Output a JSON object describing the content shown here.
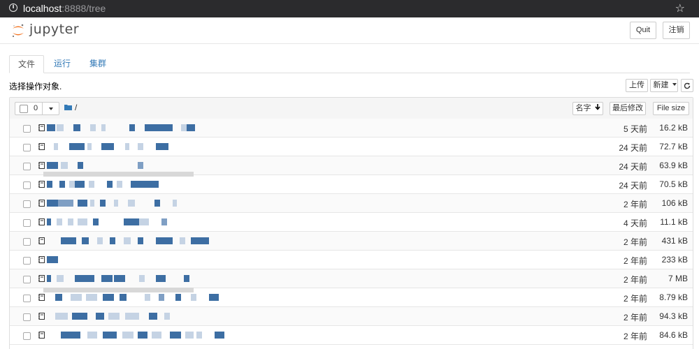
{
  "browser": {
    "url_host": "localhost",
    "url_rest": ":8888/tree"
  },
  "header": {
    "logo_text": "jupyter",
    "quit_label": "Quit",
    "logout_label": "注销"
  },
  "tabs": [
    {
      "label": "文件",
      "active": true
    },
    {
      "label": "运行",
      "active": false
    },
    {
      "label": "集群",
      "active": false
    }
  ],
  "toolbar": {
    "hint": "选择操作对象.",
    "upload_label": "上传",
    "new_label": "新建",
    "refresh_icon": "refresh-icon"
  },
  "list_header": {
    "selected_count": "0",
    "breadcrumb_root": "/",
    "sort_name_label": "名字",
    "sort_modified_label": "最后修改",
    "sort_size_label": "File size"
  },
  "files": [
    {
      "modified": "5 天前",
      "size": "16.2 kB"
    },
    {
      "modified": "24 天前",
      "size": "72.7 kB"
    },
    {
      "modified": "24 天前",
      "size": "63.9 kB"
    },
    {
      "modified": "24 天前",
      "size": "70.5 kB"
    },
    {
      "modified": "2 年前",
      "size": "106 kB"
    },
    {
      "modified": "4 天前",
      "size": "11.1 kB"
    },
    {
      "modified": "2 年前",
      "size": "431 kB"
    },
    {
      "modified": "2 年前",
      "size": "233 kB"
    },
    {
      "modified": "2 年前",
      "size": "7 MB"
    },
    {
      "modified": "2 年前",
      "size": "8.79 kB"
    },
    {
      "modified": "2 年前",
      "size": "94.3 kB"
    },
    {
      "modified": "2 年前",
      "size": "84.6 kB"
    }
  ],
  "colors": {
    "link": "#337ab7",
    "urlbar_bg": "#2b2b2d",
    "logo_orange": "#f37726",
    "blur_dark": "#3d6ea3"
  }
}
